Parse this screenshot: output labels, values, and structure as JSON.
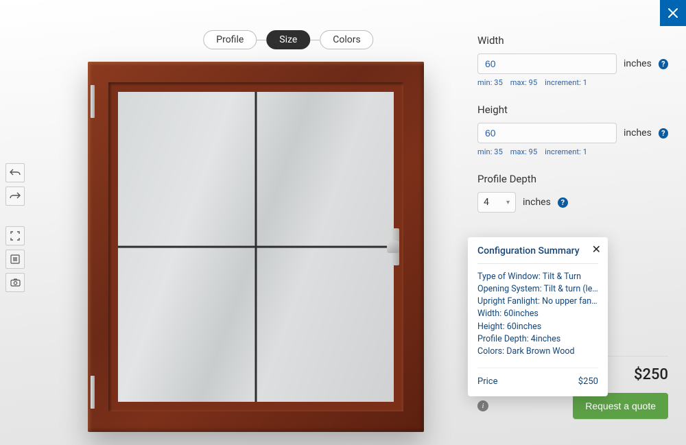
{
  "close_icon": "close",
  "steps": {
    "profile": "Profile",
    "size": "Size",
    "colors": "Colors"
  },
  "toolbar": {
    "undo": "undo",
    "redo": "redo",
    "fullscreen": "fullscreen",
    "summary": "summary",
    "snapshot": "snapshot"
  },
  "fields": {
    "width": {
      "label": "Width",
      "value": "60",
      "unit": "inches",
      "hint_min": "min: 35",
      "hint_max": "max: 95",
      "hint_inc": "increment: 1"
    },
    "height": {
      "label": "Height",
      "value": "60",
      "unit": "inches",
      "hint_min": "min: 35",
      "hint_max": "max: 95",
      "hint_inc": "increment: 1"
    },
    "depth": {
      "label": "Profile Depth",
      "value": "4",
      "unit": "inches"
    }
  },
  "summary": {
    "title": "Configuration Summary",
    "items": [
      "Type of Window: Tilt & Turn",
      "Opening System: Tilt & turn (left)",
      "Upright Fanlight: No upper fanlig...",
      "Width: 60inches",
      "Height: 60inches",
      "Profile Depth: 4inches",
      "Colors: Dark Brown Wood"
    ],
    "price_label": "Price",
    "price_value": "$250"
  },
  "price": {
    "label": "Price",
    "value": "$250"
  },
  "quote_button": "Request a quote",
  "help_glyph": "?",
  "info_glyph": "i"
}
